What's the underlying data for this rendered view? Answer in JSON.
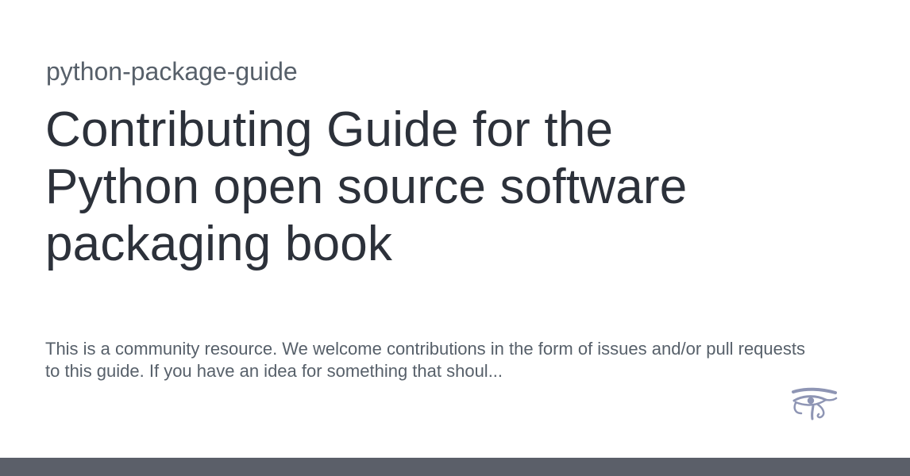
{
  "repo": {
    "name": "python-package-guide"
  },
  "title": "Contributing Guide for the Python open source software packaging book",
  "description": "This is a community resource. We welcome contributions in the form of issues and/or pull requests to this guide. If you have an idea for something that shoul...",
  "logo": {
    "icon": "eye-of-horus-icon",
    "color": "#8e95b4"
  },
  "colors": {
    "title": "#2c313a",
    "muted": "#57606a",
    "bar": "#5b5f69"
  }
}
